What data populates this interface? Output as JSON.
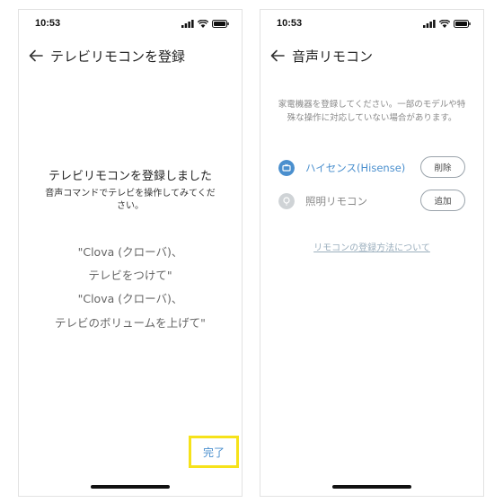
{
  "left_screen": {
    "status_time": "10:53",
    "title": "テレビリモコンを登録",
    "headline": "テレビリモコンを登録しました",
    "subtext": "音声コマンドでテレビを操作してみてください。",
    "commands": [
      "\"Clova (クローバ)、",
      "テレビをつけて\"",
      "\"Clova (クローバ)、",
      "テレビのボリュームを上げて\""
    ],
    "done_label": "完了"
  },
  "right_screen": {
    "status_time": "10:53",
    "title": "音声リモコン",
    "description": "家電機器を登録してください。一部のモデルや特殊な操作に対応していない場合があります。",
    "devices": [
      {
        "label": "ハイセンス(Hisense)",
        "icon": "tv-icon",
        "button": "削除",
        "active": true
      },
      {
        "label": "照明リモコン",
        "icon": "lightbulb-icon",
        "button": "追加",
        "active": false
      }
    ],
    "help_link": "リモコンの登録方法について"
  },
  "colors": {
    "accent_blue": "#4a8fce",
    "highlight_yellow": "#f6e21a",
    "inactive_gray": "#cfd3d6"
  }
}
